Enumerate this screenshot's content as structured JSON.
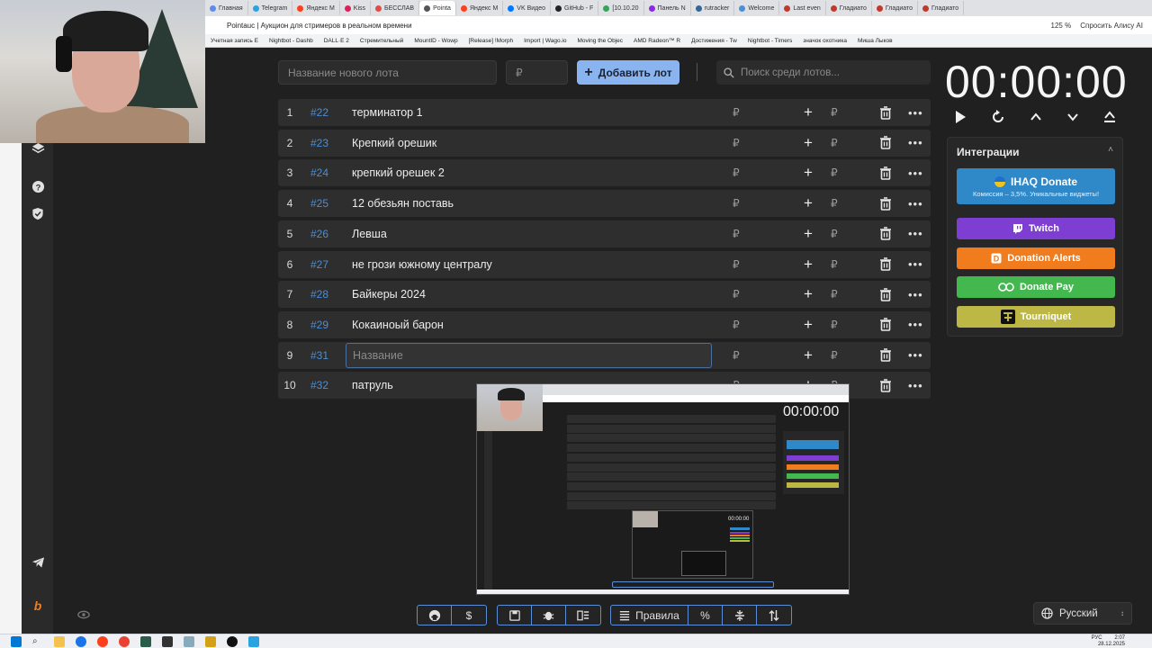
{
  "browser": {
    "tabs": [
      {
        "label": "Главная",
        "color": "#5b8def"
      },
      {
        "label": "Telegram",
        "color": "#2aa3e0"
      },
      {
        "label": "Яндекс М",
        "color": "#fc3f1d"
      },
      {
        "label": "Kiss",
        "color": "#e21e5a"
      },
      {
        "label": "БЕССЛАВ",
        "color": "#e34b4b"
      },
      {
        "label": "Pointa",
        "color": "#555555",
        "active": true
      },
      {
        "label": "Яндекс М",
        "color": "#fc3f1d"
      },
      {
        "label": "VK Видео",
        "color": "#0077ff"
      },
      {
        "label": "GitHub - F",
        "color": "#222222"
      },
      {
        "label": "[10.10.20",
        "color": "#3aa35b"
      },
      {
        "label": "Панель N",
        "color": "#8a2be2"
      },
      {
        "label": "rutracker",
        "color": "#336699"
      },
      {
        "label": "Welcome",
        "color": "#4a90d9"
      },
      {
        "label": "Last even",
        "color": "#c0392b"
      },
      {
        "label": "Гладиато",
        "color": "#c0392b"
      },
      {
        "label": "Гладиато",
        "color": "#c0392b"
      },
      {
        "label": "Гладиато",
        "color": "#c0392b"
      }
    ],
    "page_title": "Pointauc | Аукцион для стримеров в реальном времени",
    "zoom": "125 %",
    "alisa": "Спросить Алису AI",
    "bookmarks": [
      "Учетная запись E",
      "Nightbot - Dashb",
      "DALL·E 2",
      "Стремительный",
      "MountID - Wowp",
      "[Release] !Morph",
      "Import | Wago.io",
      "Moving the Objec",
      "AMD Radeon™ R",
      "Достижения - Tw",
      "Nightbot - Timers",
      "значок охотника",
      "Миша Лыков"
    ]
  },
  "toolbar": {
    "new_lot_placeholder": "Название нового лота",
    "amount_placeholder": "₽",
    "add_lot_label": "Добавить лот",
    "search_placeholder": "Поиск среди лотов..."
  },
  "lots": [
    {
      "index": "1",
      "id": "#22",
      "name": " терминатор 1",
      "currency": "₽"
    },
    {
      "index": "2",
      "id": "#23",
      "name": "Крепкий орешик",
      "currency": "₽"
    },
    {
      "index": "3",
      "id": "#24",
      "name": " крепкий орешек 2",
      "currency": "₽"
    },
    {
      "index": "4",
      "id": "#25",
      "name": " 12 обезьян поставь",
      "currency": "₽"
    },
    {
      "index": "5",
      "id": "#26",
      "name": "Левша",
      "currency": "₽"
    },
    {
      "index": "6",
      "id": "#27",
      "name": "не грози южному централу",
      "currency": "₽"
    },
    {
      "index": "7",
      "id": "#28",
      "name": "Байкеры 2024",
      "currency": "₽"
    },
    {
      "index": "8",
      "id": "#29",
      "name": "Кокаиноый барон",
      "currency": "₽"
    },
    {
      "index": "9",
      "id": "#31",
      "name": "Название",
      "currency": "₽",
      "editing": true
    },
    {
      "index": "10",
      "id": "#32",
      "name": "патруль",
      "currency": "₽"
    }
  ],
  "timer": {
    "display": "00:00:00"
  },
  "integrations": {
    "title": "Интеграции",
    "ihaq": {
      "label": "IHAQ Donate",
      "sub": "Комиссия – 3,5%. Уникальные виджеты!",
      "color": "#2f88c8"
    },
    "items": [
      {
        "label": "Twitch",
        "color": "#7d3ed1"
      },
      {
        "label": "Donation Alerts",
        "color": "#f07c1e"
      },
      {
        "label": "Donate Pay",
        "color": "#43b84f"
      },
      {
        "label": "Tourniquet",
        "color": "#bdb845"
      }
    ]
  },
  "bottom_bar": {
    "rules_label": "Правила"
  },
  "language": {
    "selected": "Русский"
  },
  "taskbar": {
    "time": "2:07",
    "date": "28.12.2025",
    "lang": "РУС"
  }
}
